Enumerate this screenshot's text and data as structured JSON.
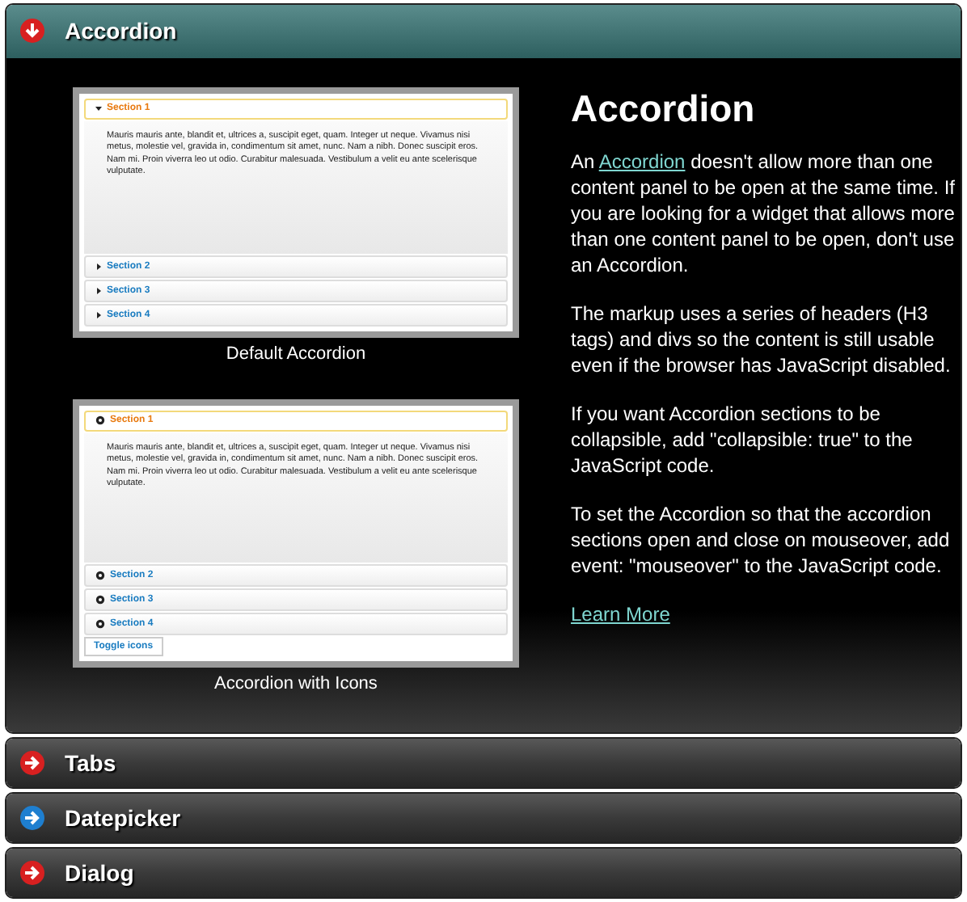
{
  "sections": [
    {
      "title": "Accordion",
      "expanded": true,
      "hovered": false
    },
    {
      "title": "Tabs",
      "expanded": false,
      "hovered": false
    },
    {
      "title": "Datepicker",
      "expanded": false,
      "hovered": true
    },
    {
      "title": "Dialog",
      "expanded": false,
      "hovered": false
    }
  ],
  "figures": [
    {
      "kind": "arrows",
      "caption": "Default Accordion",
      "body": "Mauris mauris ante, blandit et, ultrices a, suscipit eget, quam. Integer ut neque. Vivamus nisi metus, molestie vel, gravida in, condimentum sit amet, nunc. Nam a nibh. Donec suscipit eros. Nam mi. Proin viverra leo ut odio. Curabitur malesuada. Vestibulum a velit eu ante scelerisque vulputate.",
      "panels": [
        {
          "label": "Section 1",
          "expanded": true
        },
        {
          "label": "Section 2",
          "expanded": false
        },
        {
          "label": "Section 3",
          "expanded": false
        },
        {
          "label": "Section 4",
          "expanded": false
        }
      ]
    },
    {
      "kind": "circles",
      "caption": "Accordion with Icons",
      "body": "Mauris mauris ante, blandit et, ultrices a, suscipit eget, quam. Integer ut neque. Vivamus nisi metus, molestie vel, gravida in, condimentum sit amet, nunc. Nam a nibh. Donec suscipit eros. Nam mi. Proin viverra leo ut odio. Curabitur malesuada. Vestibulum a velit eu ante scelerisque vulputate.",
      "panels": [
        {
          "label": "Section 1",
          "expanded": true
        },
        {
          "label": "Section 2",
          "expanded": false
        },
        {
          "label": "Section 3",
          "expanded": false
        },
        {
          "label": "Section 4",
          "expanded": false
        }
      ],
      "button": "Toggle icons"
    }
  ],
  "article": {
    "heading": "Accordion",
    "intro": {
      "before": "An ",
      "link": "Accordion",
      "after": " doesn't allow more than one content panel to be open at the same time. If you are looking for a widget that allows more than one content panel to be open, don't use an Accordion."
    },
    "paragraphs": [
      "The markup uses a series of headers (H3 tags) and divs so the content is still usable even if the browser has JavaScript disabled.",
      "If you want Accordion sections to be collapsible, add \"collapsible: true\" to the JavaScript code.",
      "To set the Accordion so that the accordion sections open and close on mouseover, add event: \"mouseover\" to the JavaScript code."
    ],
    "more_link": "Learn More"
  }
}
